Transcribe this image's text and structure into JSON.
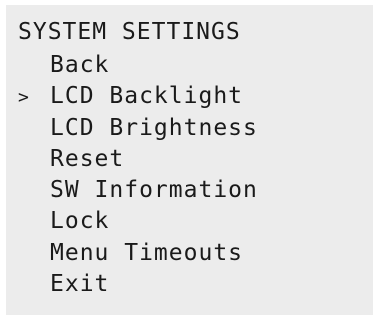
{
  "screen": {
    "title": "SYSTEM SETTINGS",
    "cursor_glyph": ">",
    "selected_index": 1,
    "items": [
      {
        "label": "Back"
      },
      {
        "label": "LCD Backlight"
      },
      {
        "label": "LCD Brightness"
      },
      {
        "label": "Reset"
      },
      {
        "label": "SW Information"
      },
      {
        "label": "Lock"
      },
      {
        "label": "Menu Timeouts"
      },
      {
        "label": "Exit"
      }
    ]
  },
  "colors": {
    "screen_background": "#ececec",
    "text": "#1a1a1a"
  }
}
